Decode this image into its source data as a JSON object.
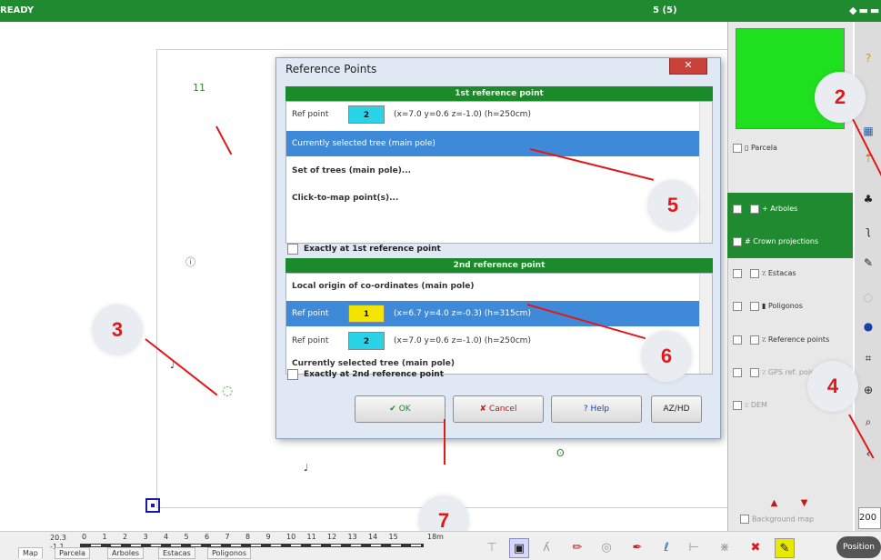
{
  "topbar": {
    "status": "READY",
    "count": "5 (5)",
    "controls": "◆▬▬"
  },
  "map": {
    "trees": [
      {
        "label": "11",
        "kind": "sapling"
      },
      {
        "label": "ⓘ",
        "kind": "pole"
      },
      {
        "label": "♩",
        "kind": "sapling"
      },
      {
        "label": "◌",
        "kind": "selected"
      },
      {
        "label": "♩",
        "kind": "sapling"
      },
      {
        "label": "ʘ",
        "kind": "pole"
      }
    ]
  },
  "callouts": [
    "2",
    "3",
    "4",
    "5",
    "6",
    "7"
  ],
  "dialog": {
    "title": "Reference Points",
    "close": "✕",
    "first_header": "1st reference point",
    "first_rows": [
      {
        "label": "Ref point",
        "num": "2",
        "coords": "(x=7.0 y=0.6 z=-1.0) (h=250cm)"
      },
      {
        "label": "Currently selected tree (main pole)"
      },
      {
        "label": "Set of trees (main pole)..."
      },
      {
        "label": "Click-to-map point(s)..."
      }
    ],
    "first_exact": "Exactly at 1st reference point",
    "second_header": "2nd reference point",
    "second_rows": [
      {
        "label": "Local origin of co-ordinates (main pole)"
      },
      {
        "label": "Ref point",
        "num": "1",
        "coords": "(x=6.7 y=4.0 z=-0.3) (h=315cm)"
      },
      {
        "label": "Ref point",
        "num": "2",
        "coords": "(x=7.0 y=0.6 z=-1.0) (h=250cm)"
      },
      {
        "label": "Currently selected tree (main pole)"
      }
    ],
    "second_exact": "Exactly at 2nd reference point",
    "buttons": {
      "ok": "✔ OK",
      "cancel": "✘ Cancel",
      "help": "? Help",
      "az": "AZ/HD"
    }
  },
  "layers": [
    {
      "label": "▯ Parcela",
      "checked": true
    },
    {
      "label": "+ Arboles",
      "checked": true
    },
    {
      "label": "# Crown projections",
      "checked": true
    },
    {
      "label": "٪ Estacas",
      "checked": true
    },
    {
      "label": "▮ Poligonos",
      "checked": true
    },
    {
      "label": "٪ Reference points",
      "checked": true
    },
    {
      "label": "٪ GPS ref. points",
      "checked": false
    },
    {
      "label": "٪ DEM",
      "checked": false
    }
  ],
  "background_map": "Background map",
  "zoom_value": "200",
  "scale": {
    "origin_top": "20.3",
    "origin_bottom": "-1.1",
    "ticks": [
      "0",
      "1",
      "2",
      "3",
      "4",
      "5",
      "6",
      "7",
      "8",
      "9",
      "10",
      "11",
      "12",
      "13",
      "14",
      "15",
      "18m"
    ]
  },
  "position_button": "Position",
  "tabs": [
    "Map",
    "Parcela",
    "Arboles",
    "Estacas",
    "Poligonos"
  ],
  "colors": {
    "accent_green": "#1f8a2f",
    "selection_blue": "#3f8ad8",
    "callout_red": "#e0191b",
    "cyan_box": "#29d3e8",
    "yellow_box": "#f5e400"
  }
}
